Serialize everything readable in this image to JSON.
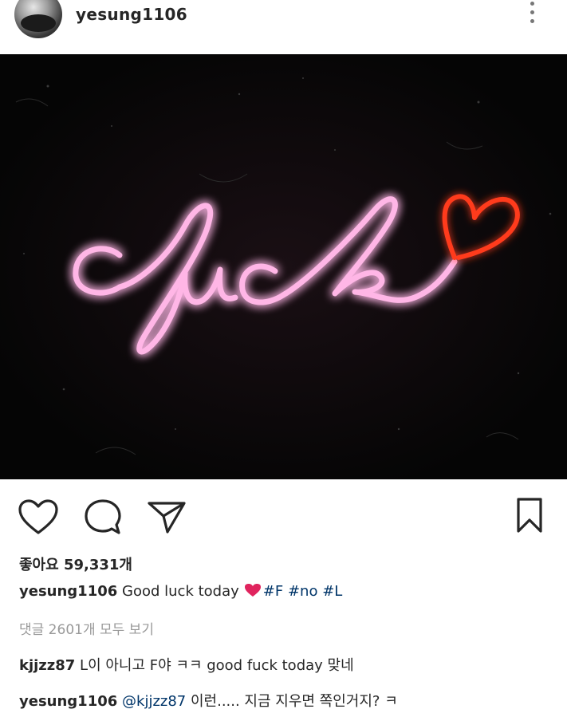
{
  "post": {
    "username": "yesung1106",
    "image_text": "fuck",
    "likes_text": "좋아요 59,331개",
    "caption": {
      "username": "yesung1106",
      "text": "Good luck today",
      "hashtags": [
        "#F",
        "#no",
        "#L"
      ]
    },
    "view_comments_text": "댓글 2601개 모두 보기",
    "comments": [
      {
        "username": "kjjzz87",
        "text": "L이 아니고 F야 ㅋㅋ good fuck today 맞네"
      },
      {
        "username": "yesung1106",
        "mention": "@kjjzz87",
        "text": "이런..... 지금 지우면 쪽인거지? ㅋ"
      }
    ]
  },
  "icons": {
    "like": "heart-icon",
    "comment": "comment-bubble-icon",
    "share": "paper-plane-icon",
    "save": "bookmark-icon",
    "more": "more-vertical-icon"
  },
  "colors": {
    "neon_pink": "#ffb6e6",
    "neon_red": "#ff3b1f",
    "hashtag": "#003569",
    "muted": "#999999"
  }
}
